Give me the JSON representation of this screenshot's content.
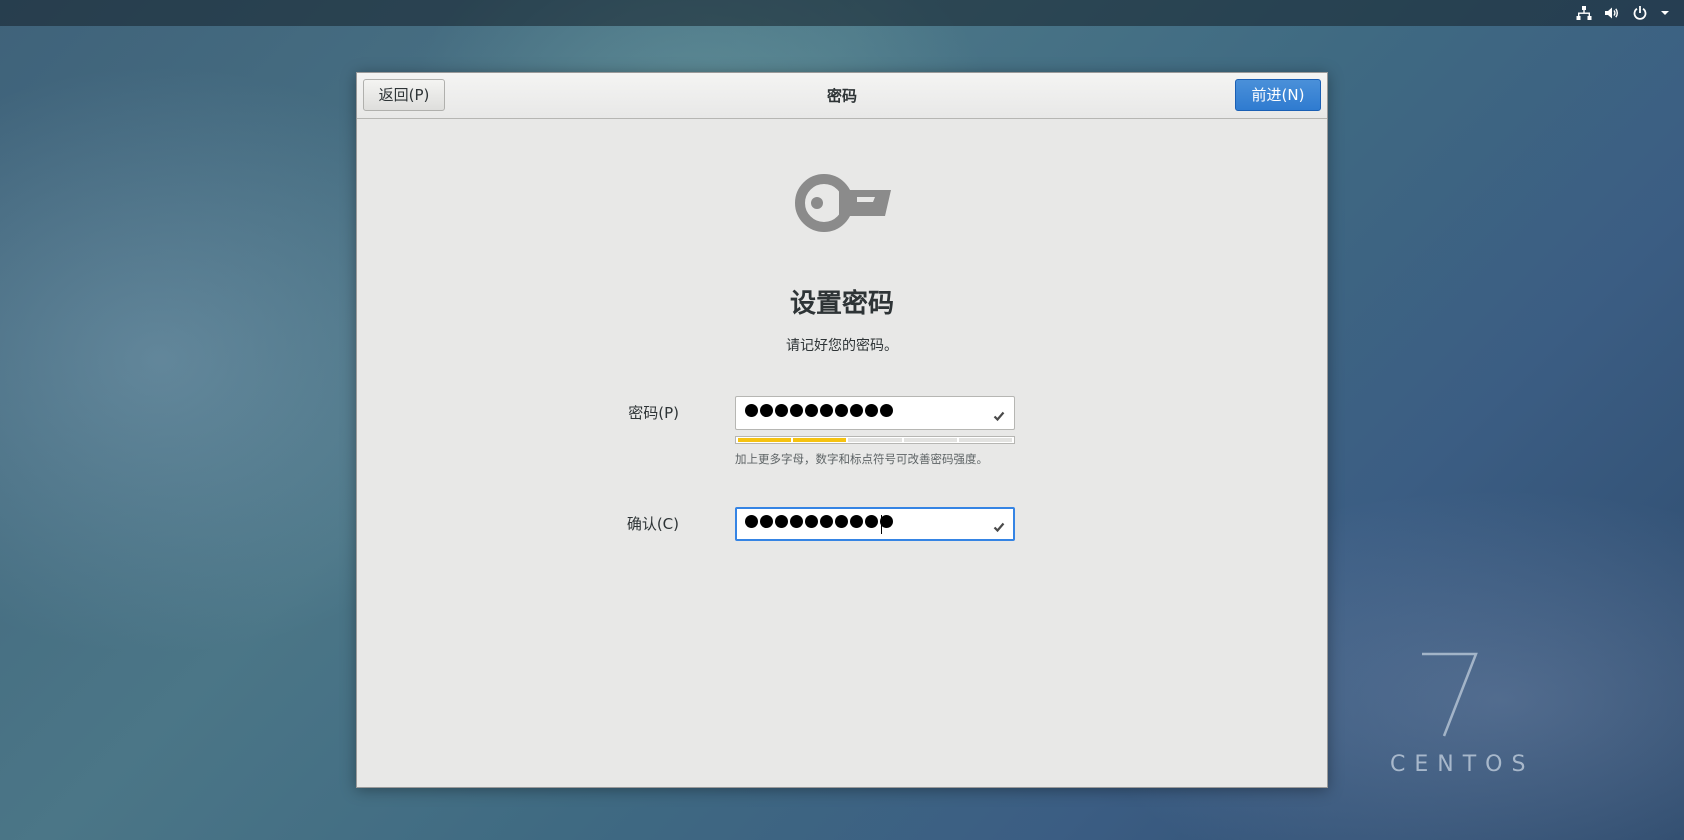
{
  "topbar": {
    "icons": [
      "network-icon",
      "volume-icon",
      "power-icon",
      "dropdown-arrow-icon"
    ]
  },
  "dialog": {
    "header": {
      "back_label": "返回(P)",
      "title": "密码",
      "next_label": "前进(N)"
    },
    "icon": "key-icon",
    "title": "设置密码",
    "subtitle": "请记好您的密码。",
    "password": {
      "label": "密码(P)",
      "masked_length": 10,
      "valid": true
    },
    "strength": {
      "segments_total": 5,
      "segments_filled": 2,
      "hint": "加上更多字母，数字和标点符号可改善密码强度。"
    },
    "confirm": {
      "label": "确认(C)",
      "masked_length": 10,
      "valid": true,
      "focused": true
    }
  },
  "watermark": {
    "numeral": "7",
    "name": "CENTOS"
  },
  "colors": {
    "accent": "#3584e4",
    "strength_fill": "#f5c211",
    "dialog_bg": "#e8e8e7"
  }
}
